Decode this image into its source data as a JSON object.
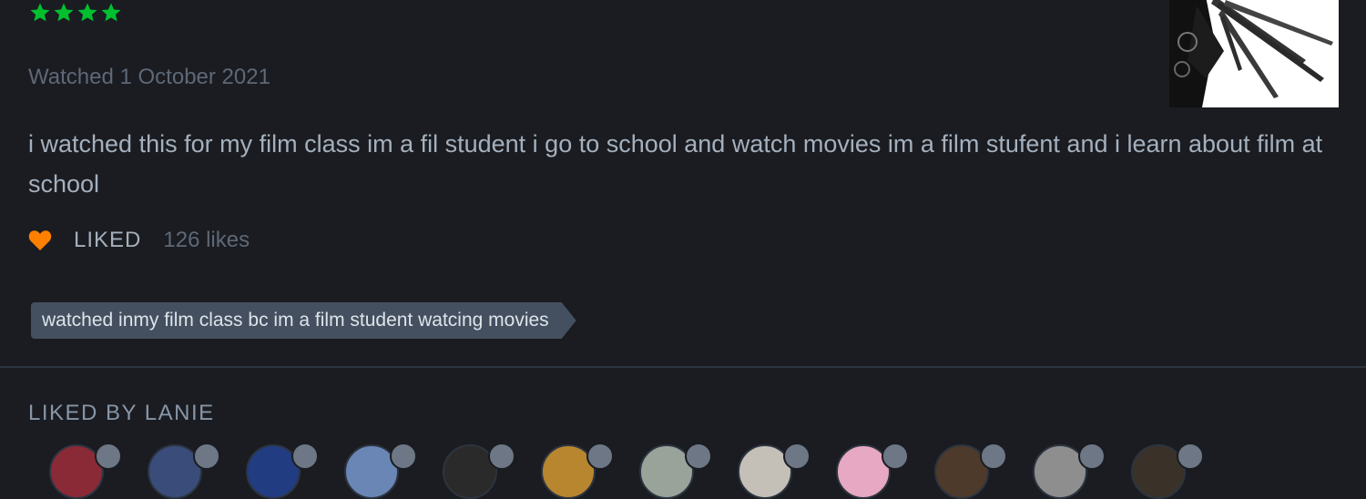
{
  "review": {
    "rating_stars": 4,
    "star_color": "#00c030",
    "watched_date": "Watched 1 October 2021",
    "text": "i watched this for my film class im a fil student i go to school and watch movies im a film stufent and i learn about film at school",
    "liked_label": "LIKED",
    "likes_count": "126 likes",
    "heart_color": "#ff8000",
    "tag": "watched inmy film class bc im a film student watcing movies"
  },
  "poster": {
    "icon": "film-poster-image"
  },
  "liked_by": {
    "title": "LIKED BY LANIE",
    "avatar_colors": [
      "#8a2a36",
      "#3a4c7a",
      "#223c82",
      "#6a86b4",
      "#2a2a2a",
      "#b8862e",
      "#9aa39a",
      "#c4c0b8",
      "#e6a8c2",
      "#4e3a2a",
      "#8e8e8e",
      "#3a3228"
    ]
  }
}
